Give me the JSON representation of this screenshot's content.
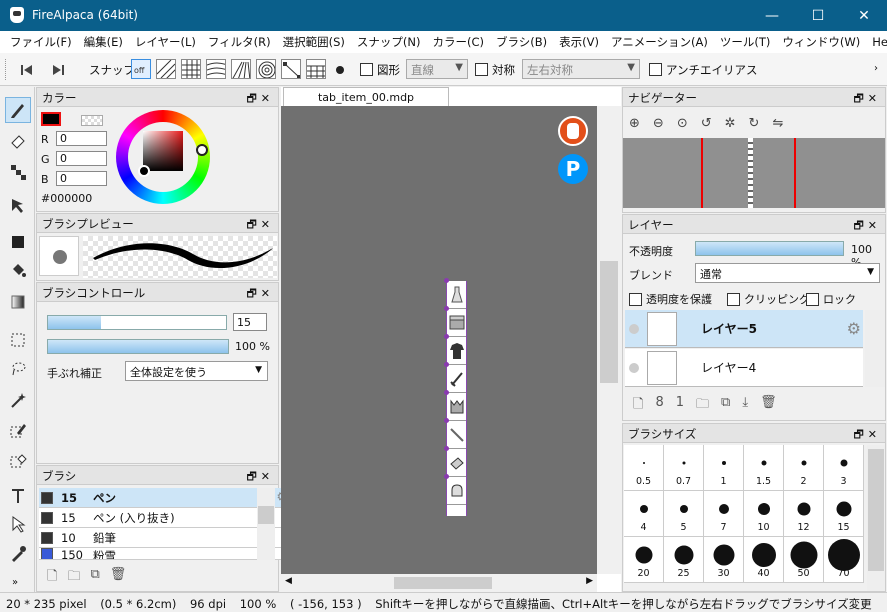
{
  "window": {
    "title": "FireAlpaca (64bit)",
    "minimize": "—",
    "maximize": "☐",
    "close": "✕"
  },
  "menu": [
    "ファイル(F)",
    "編集(E)",
    "レイヤー(L)",
    "フィルタ(R)",
    "選択範囲(S)",
    "スナップ(N)",
    "カラー(C)",
    "ブラシ(B)",
    "表示(V)",
    "アニメーション(A)",
    "ツール(T)",
    "ウィンドウ(W)",
    "Help"
  ],
  "toolbar": {
    "snap_label": "スナップ",
    "snap_off": "off",
    "figure_label": "図形",
    "figure_value": "直線",
    "symmetry_label": "対称",
    "symmetry_value": "左右対称",
    "antialias_label": "アンチエイリアス"
  },
  "color_panel": {
    "title": "カラー",
    "r_label": "R",
    "g_label": "G",
    "b_label": "B",
    "r": "0",
    "g": "0",
    "b": "0",
    "hex": "#000000",
    "current_color": "#000000"
  },
  "brush_preview": {
    "title": "ブラシプレビュー"
  },
  "brush_control": {
    "title": "ブラシコントロール",
    "size": "15",
    "size_fraction": 0.3,
    "opacity": "100 %",
    "opacity_fraction": 1.0,
    "stabilizer_label": "手ぶれ補正",
    "stabilizer_value": "全体設定を使う"
  },
  "brush_list": {
    "title": "ブラシ",
    "items": [
      {
        "size": "15",
        "name": "ペン",
        "color": "#333333"
      },
      {
        "size": "15",
        "name": "ペン (入り抜き)",
        "color": "#333333"
      },
      {
        "size": "10",
        "name": "鉛筆",
        "color": "#333333"
      },
      {
        "size": "150",
        "name": "粉雪",
        "color": "#3a5ad8"
      }
    ]
  },
  "canvas": {
    "tab": "tab_item_00.mdp"
  },
  "navigator": {
    "title": "ナビゲーター"
  },
  "layer_panel": {
    "title": "レイヤー",
    "opacity_label": "不透明度",
    "opacity_value": "100 %",
    "opacity_fraction": 1.0,
    "blend_label": "ブレンド",
    "blend_value": "通常",
    "protect_label": "透明度を保護",
    "clipping_label": "クリッピング",
    "lock_label": "ロック",
    "layers": [
      {
        "name": "レイヤー5",
        "selected": true
      },
      {
        "name": "レイヤー4",
        "selected": false
      }
    ]
  },
  "brush_size_panel": {
    "title": "ブラシサイズ",
    "sizes": [
      {
        "label": "0.5",
        "dot": 0.4
      },
      {
        "label": "0.7",
        "dot": 0.6
      },
      {
        "label": "1",
        "dot": 1
      },
      {
        "label": "1.5",
        "dot": 1.5
      },
      {
        "label": "2",
        "dot": 2
      },
      {
        "label": "3",
        "dot": 3
      },
      {
        "label": "4",
        "dot": 4
      },
      {
        "label": "5",
        "dot": 5
      },
      {
        "label": "7",
        "dot": 7
      },
      {
        "label": "10",
        "dot": 10
      },
      {
        "label": "12",
        "dot": 12
      },
      {
        "label": "15",
        "dot": 15
      },
      {
        "label": "20",
        "dot": 20
      },
      {
        "label": "25",
        "dot": 25
      },
      {
        "label": "30",
        "dot": 30
      },
      {
        "label": "40",
        "dot": 40
      },
      {
        "label": "50",
        "dot": 50
      },
      {
        "label": "70",
        "dot": 70
      }
    ]
  },
  "status": {
    "size": "20 * 235 pixel",
    "physical": "(0.5 * 6.2cm)",
    "dpi": "96 dpi",
    "zoom": "100 %",
    "coords": "( -156, 153 )",
    "hint": "Shiftキーを押しながらで直線描画、Ctrl+Altキーを押しながら左右ドラッグでブラシサイズ変更"
  }
}
